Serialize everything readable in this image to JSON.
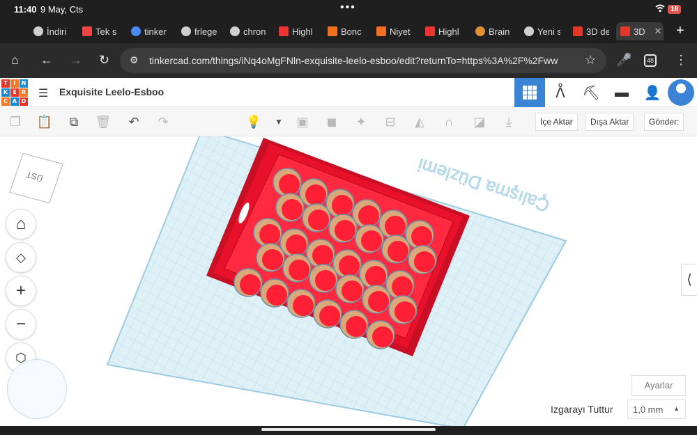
{
  "status": {
    "time": "11:40",
    "date": "9 May, Cts",
    "dots": "•••",
    "battery": "18"
  },
  "tabs": [
    {
      "label": "İndiri"
    },
    {
      "label": "Tek s"
    },
    {
      "label": "tinker"
    },
    {
      "label": "frlege"
    },
    {
      "label": "chron"
    },
    {
      "label": "Highl"
    },
    {
      "label": "Bonc"
    },
    {
      "label": "Niyet"
    },
    {
      "label": "Highl"
    },
    {
      "label": "Brain"
    },
    {
      "label": "Yeni s"
    },
    {
      "label": "3D de"
    },
    {
      "label": "3D"
    }
  ],
  "browser": {
    "url": "tinkercad.com/things/iNq4oMgFNln-exquisite-leelo-esboo/edit?returnTo=https%3A%2F%2Fww",
    "tab_count": "48"
  },
  "app": {
    "logo_letters": [
      "T",
      "I",
      "N",
      "K",
      "E",
      "R",
      "C",
      "A",
      "D"
    ],
    "design_title": "Exquisite Leelo-Esboo",
    "toolbar": {
      "import": "İçe Aktar",
      "export": "Dışa Aktar",
      "send": "Gönder:"
    },
    "viewcube_label": "ÜST",
    "workplane_label": "Çalışma Düzlemi",
    "settings_button": "Ayarlar",
    "snap_label": "Izgarayı Tuttur",
    "snap_value": "1,0 mm"
  },
  "colors": {
    "accent": "#3b83d4",
    "object": "#e8102a",
    "workplane": "#dff0f7",
    "logo_red": "#e2372a",
    "logo_orange": "#f07a2a",
    "logo_blue": "#1f8ad0"
  }
}
